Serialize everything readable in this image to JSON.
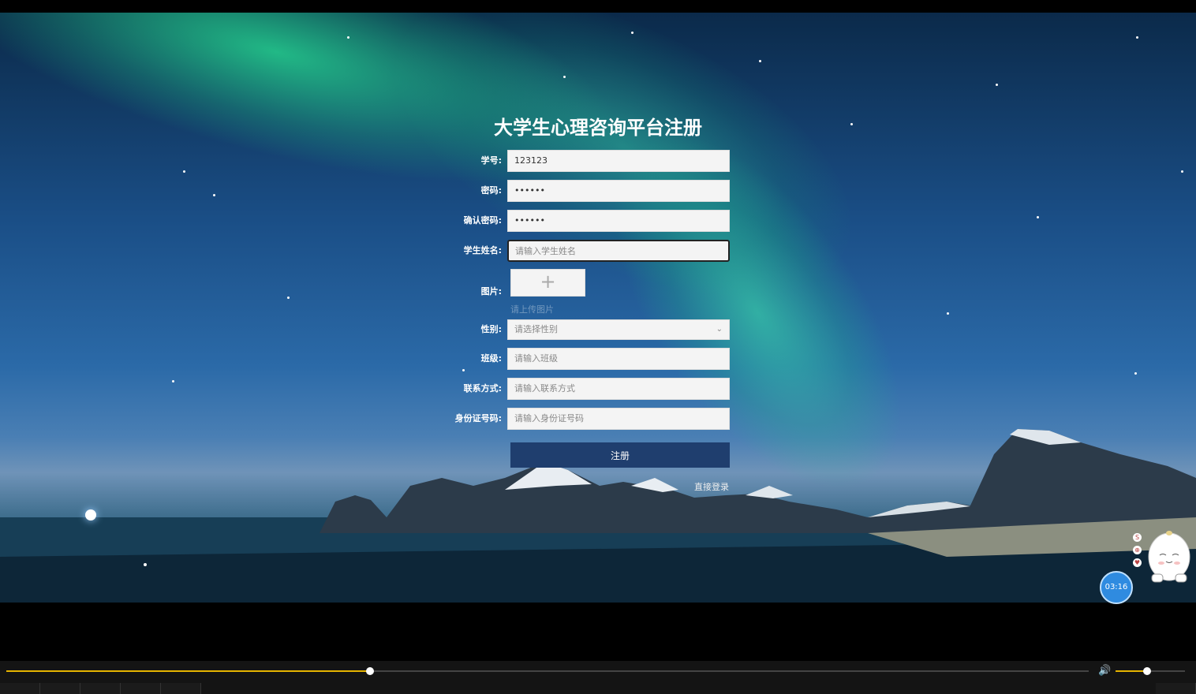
{
  "page": {
    "title": "大学生心理咨询平台注册"
  },
  "form": {
    "fields": [
      {
        "label": "学号:",
        "value": "123123",
        "placeholder": ""
      },
      {
        "label": "密码:",
        "value": "••••••",
        "placeholder": ""
      },
      {
        "label": "确认密码:",
        "value": "••••••",
        "placeholder": ""
      },
      {
        "label": "学生姓名:",
        "value": "",
        "placeholder": "请输入学生姓名"
      }
    ],
    "image": {
      "label": "图片:",
      "plus": "+",
      "hint": "请上传图片"
    },
    "gender": {
      "label": "性别:",
      "placeholder": "请选择性别",
      "arrow": "⌄"
    },
    "more": [
      {
        "label": "班级:",
        "placeholder": "请输入班级"
      },
      {
        "label": "联系方式:",
        "placeholder": "请输入联系方式"
      },
      {
        "label": "身份证号码:",
        "placeholder": "请输入身份证号码"
      }
    ],
    "submit_label": "注册",
    "direct_login": "直接登录"
  },
  "widget": {
    "timer": "03:16",
    "mini_buttons": [
      "S",
      "⊕",
      "♥"
    ]
  },
  "player": {
    "progress": 0.336,
    "volume": 0.45,
    "volume_icon": "🔊",
    "colors": {
      "progress": "#e6b400",
      "button": "#1f3e6e"
    }
  }
}
